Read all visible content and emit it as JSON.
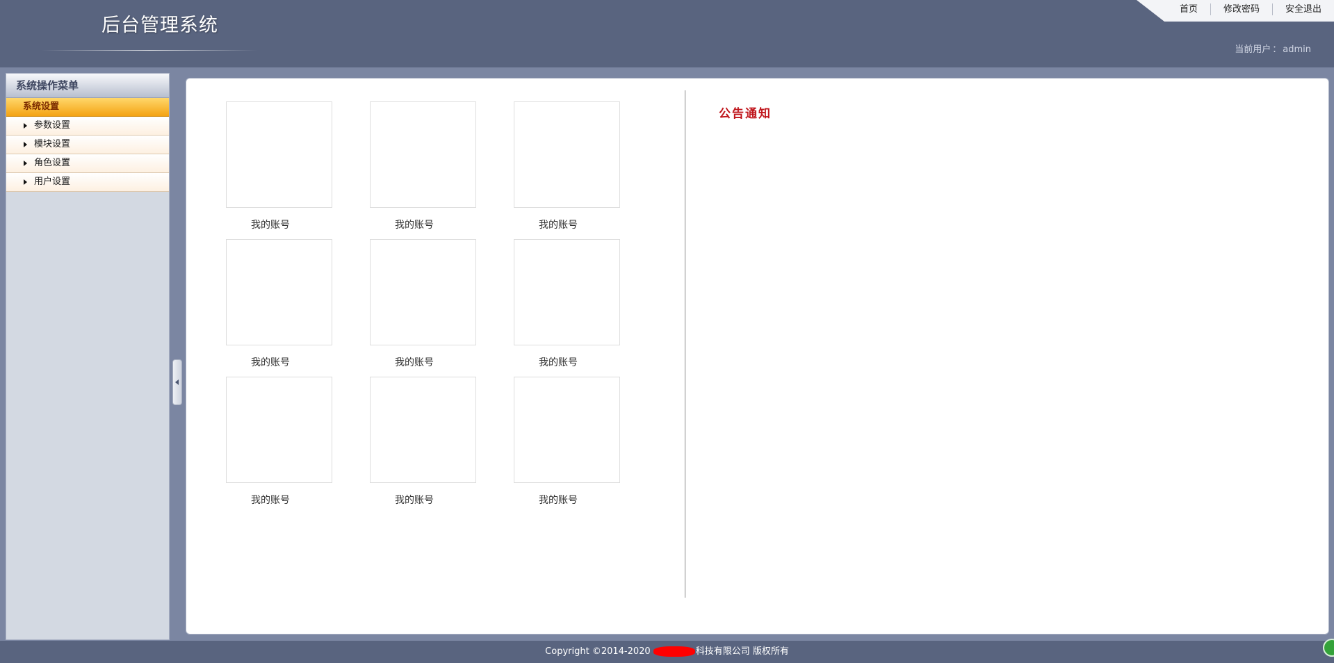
{
  "header": {
    "app_title": "后台管理系统",
    "nav": [
      {
        "label": "首页"
      },
      {
        "label": "修改密码"
      },
      {
        "label": "安全退出"
      }
    ],
    "current_user_label": "当前用户",
    "current_user_sep": "：",
    "current_user_name": "admin"
  },
  "sidebar": {
    "title": "系统操作菜单",
    "group_label": "系统设置",
    "items": [
      {
        "label": "参数设置",
        "icon": "triangle-right-icon"
      },
      {
        "label": "模块设置",
        "icon": "triangle-right-icon"
      },
      {
        "label": "角色设置",
        "icon": "triangle-right-icon"
      },
      {
        "label": "用户设置",
        "icon": "triangle-right-icon"
      }
    ]
  },
  "tiles": [
    {
      "label": "我的账号"
    },
    {
      "label": "我的账号"
    },
    {
      "label": "我的账号"
    },
    {
      "label": "我的账号"
    },
    {
      "label": "我的账号"
    },
    {
      "label": "我的账号"
    },
    {
      "label": "我的账号"
    },
    {
      "label": "我的账号"
    },
    {
      "label": "我的账号"
    }
  ],
  "notice": {
    "title": "公告通知"
  },
  "footer": {
    "copyright_prefix": "Copyright ©2014-2020",
    "copyright_suffix": "科技有限公司 版权所有"
  },
  "colors": {
    "header_bg": "#59647f",
    "menu_group_accent": "#f4a313",
    "notice_title": "#c0161c"
  }
}
